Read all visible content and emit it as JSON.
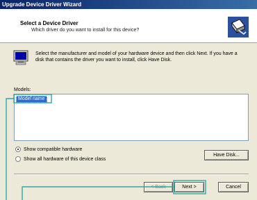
{
  "window": {
    "title": "Upgrade Device Driver Wizard"
  },
  "header": {
    "title": "Select a Device Driver",
    "subtitle": "Which driver do you want to install for this device?"
  },
  "description": "Select the manufacturer and model of your hardware device and then click Next. If you have a disk that contains the driver you want to install, click Have Disk.",
  "models": {
    "label": "Models:",
    "items": [
      "Model name"
    ]
  },
  "options": {
    "show_compatible": "Show compatible hardware",
    "show_all": "Show all hardware of this device class",
    "selected": "show_compatible"
  },
  "buttons": {
    "have_disk": "Have Disk...",
    "back": "< Back",
    "next": "Next >",
    "cancel": "Cancel"
  },
  "colors": {
    "callout": "#2aa9a9",
    "selection": "#316ac5",
    "titlebar": "#0a246a"
  }
}
